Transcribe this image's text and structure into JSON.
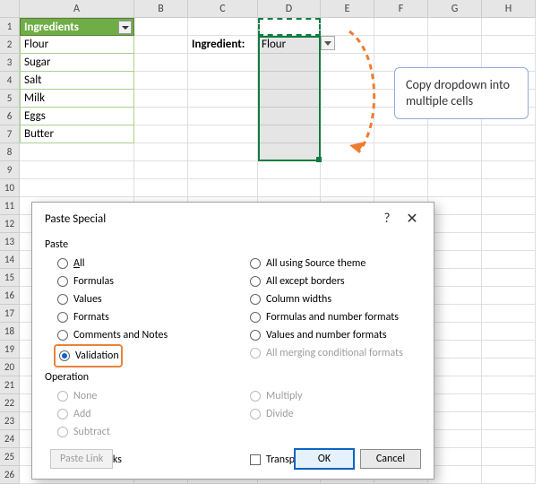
{
  "columns": [
    "A",
    "B",
    "C",
    "D",
    "E",
    "F",
    "G",
    "H"
  ],
  "rows": [
    "1",
    "2",
    "3",
    "4",
    "5",
    "6",
    "7",
    "8",
    "9",
    "10",
    "11",
    "12",
    "13",
    "14",
    "15",
    "16",
    "17",
    "18",
    "19",
    "20",
    "21",
    "22",
    "23",
    "24",
    "25",
    "26"
  ],
  "table": {
    "header": "Ingredients",
    "items": [
      "Flour",
      "Sugar",
      "Salt",
      "Milk",
      "Eggs",
      "Butter"
    ]
  },
  "label_ingredient": "Ingredient:",
  "d2_value": "Flour",
  "callout_text": "Copy dropdown into multiple cells",
  "dialog": {
    "title": "Paste Special",
    "help": "?",
    "close": "✕",
    "paste_label": "Paste",
    "operation_label": "Operation",
    "left": {
      "all": "All",
      "formulas": "Formulas",
      "values": "Values",
      "formats": "Formats",
      "comments": "Comments and Notes",
      "validation": "Validation"
    },
    "right": {
      "source_theme": "All using Source theme",
      "except_borders": "All except borders",
      "col_widths": "Column widths",
      "formulas_num": "Formulas and number formats",
      "values_num": "Values and number formats",
      "merging": "All merging conditional formats"
    },
    "op": {
      "none": "None",
      "add": "Add",
      "subtract": "Subtract",
      "multiply": "Multiply",
      "divide": "Divide"
    },
    "skip_blanks": "Skip blanks",
    "transpose": "Transpose",
    "paste_link": "Paste Link",
    "ok": "OK",
    "cancel": "Cancel"
  }
}
